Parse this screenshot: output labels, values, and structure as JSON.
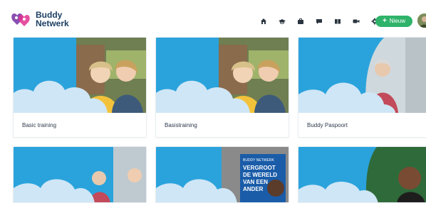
{
  "brand": {
    "line1": "Buddy",
    "line2": "Netwerk"
  },
  "nav": {
    "items": [
      {
        "name": "home-icon"
      },
      {
        "name": "graduation-cap-icon"
      },
      {
        "name": "briefcase-icon"
      },
      {
        "name": "chat-icon"
      },
      {
        "name": "book-icon"
      },
      {
        "name": "video-icon"
      },
      {
        "name": "gear-icon"
      }
    ],
    "new_button": {
      "icon": "plus-icon",
      "label": "Nieuw"
    }
  },
  "user": {
    "avatar": "user-avatar"
  },
  "cards": [
    {
      "title": "Basic training",
      "image": "two-smiling-women-photo"
    },
    {
      "title": "Basistraining",
      "image": "two-smiling-women-photo"
    },
    {
      "title": "Buddy Paspoort",
      "image": "two-people-outdoor-photo"
    },
    {
      "title": "",
      "image": "two-people-outdoor-photo"
    },
    {
      "title": "",
      "image": "poster-photo",
      "poster_lines": [
        "BUDDY NETWERK",
        "VERGROOT",
        "DE WERELD",
        "VAN EEN",
        "ANDER"
      ]
    },
    {
      "title": "",
      "image": "smiling-man-photo"
    }
  ],
  "colors": {
    "accent_blue": "#2aa3dc",
    "new_button": "#2fb36a",
    "cloud": "#cfe6f6",
    "logo_text": "#1d3f63"
  }
}
